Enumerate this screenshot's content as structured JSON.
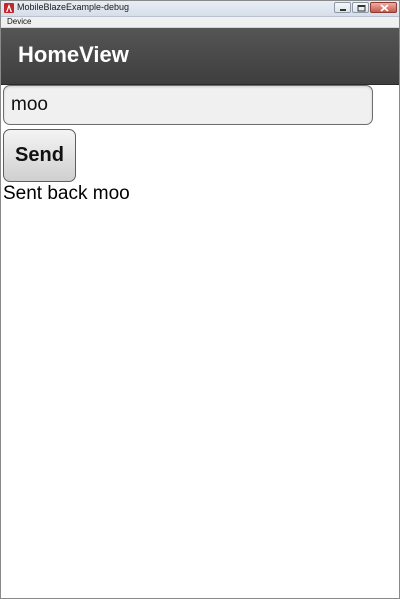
{
  "window": {
    "title": "MobileBlazeExample-debug",
    "menu": [
      "Device"
    ],
    "controls": [
      "minimize-icon",
      "maximize-icon",
      "close-icon"
    ]
  },
  "actionbar": {
    "title": "HomeView"
  },
  "form": {
    "input_value": "moo",
    "send_label": "Send",
    "result_text": "Sent back moo"
  },
  "colors": {
    "actionbar_bg": "#4a4a4a",
    "actionbar_text": "#ffffff",
    "input_bg": "#f0f0f0",
    "app_icon": "#c0282b"
  }
}
